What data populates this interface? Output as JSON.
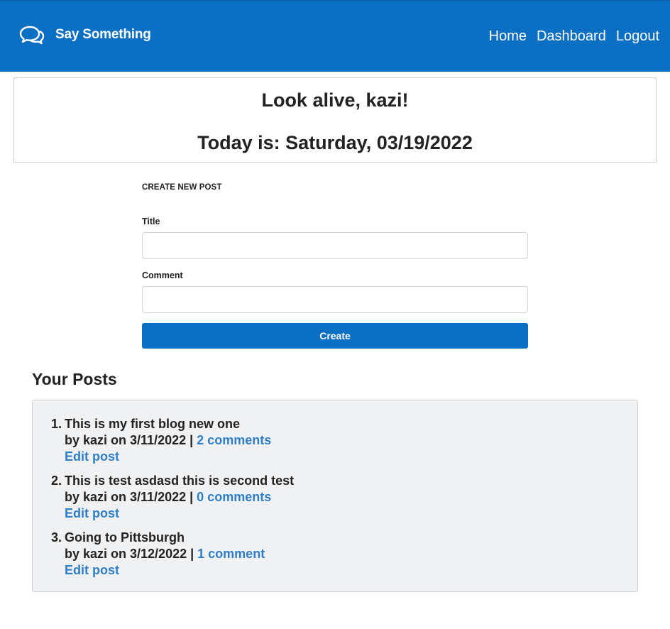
{
  "navbar": {
    "brand": "Say Something",
    "links": [
      "Home",
      "Dashboard",
      "Logout"
    ]
  },
  "greeting": {
    "welcome": "Look alive, kazi!",
    "date": "Today is: Saturday, 03/19/2022"
  },
  "form": {
    "heading": "CREATE NEW POST",
    "title_label": "Title",
    "title_value": "",
    "comment_label": "Comment",
    "comment_value": "",
    "submit_label": "Create"
  },
  "posts": {
    "heading": "Your Posts",
    "items": [
      {
        "num": "1.",
        "title": "This is my first blog new one",
        "byline": "by kazi on 3/11/2022 |",
        "comments": "2 comments",
        "edit": "Edit post"
      },
      {
        "num": "2.",
        "title": "This is test asdasd this is second test",
        "byline": "by kazi on 3/11/2022 |",
        "comments": "0 comments",
        "edit": "Edit post"
      },
      {
        "num": "3.",
        "title": "Going to Pittsburgh",
        "byline": "by kazi on 3/12/2022 |",
        "comments": "1 comment",
        "edit": "Edit post"
      }
    ]
  },
  "icons": {
    "brand_icon": "chat-bubbles-icon"
  },
  "colors": {
    "primary": "#0b6fc3",
    "link": "#2f7ec6",
    "panel_bg": "#f0f1f3"
  }
}
